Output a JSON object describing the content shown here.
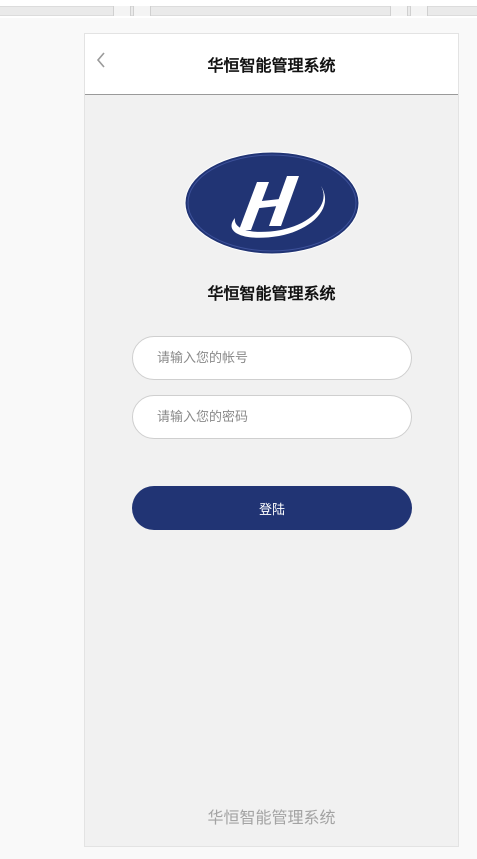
{
  "nav": {
    "title": "华恒智能管理系统"
  },
  "brand": {
    "name": "华恒智能管理系统"
  },
  "login_form": {
    "account_placeholder": "请输入您的帐号",
    "password_placeholder": "请输入您的密码",
    "submit_label": "登陆"
  },
  "footer": {
    "text": "华恒智能管理系统"
  },
  "colors": {
    "accent": "#213474",
    "page_background": "#f1f1f1",
    "footer_text": "#a3a3a3"
  },
  "icons": {
    "back": "chevron-left-icon",
    "logo": "company-logo"
  }
}
